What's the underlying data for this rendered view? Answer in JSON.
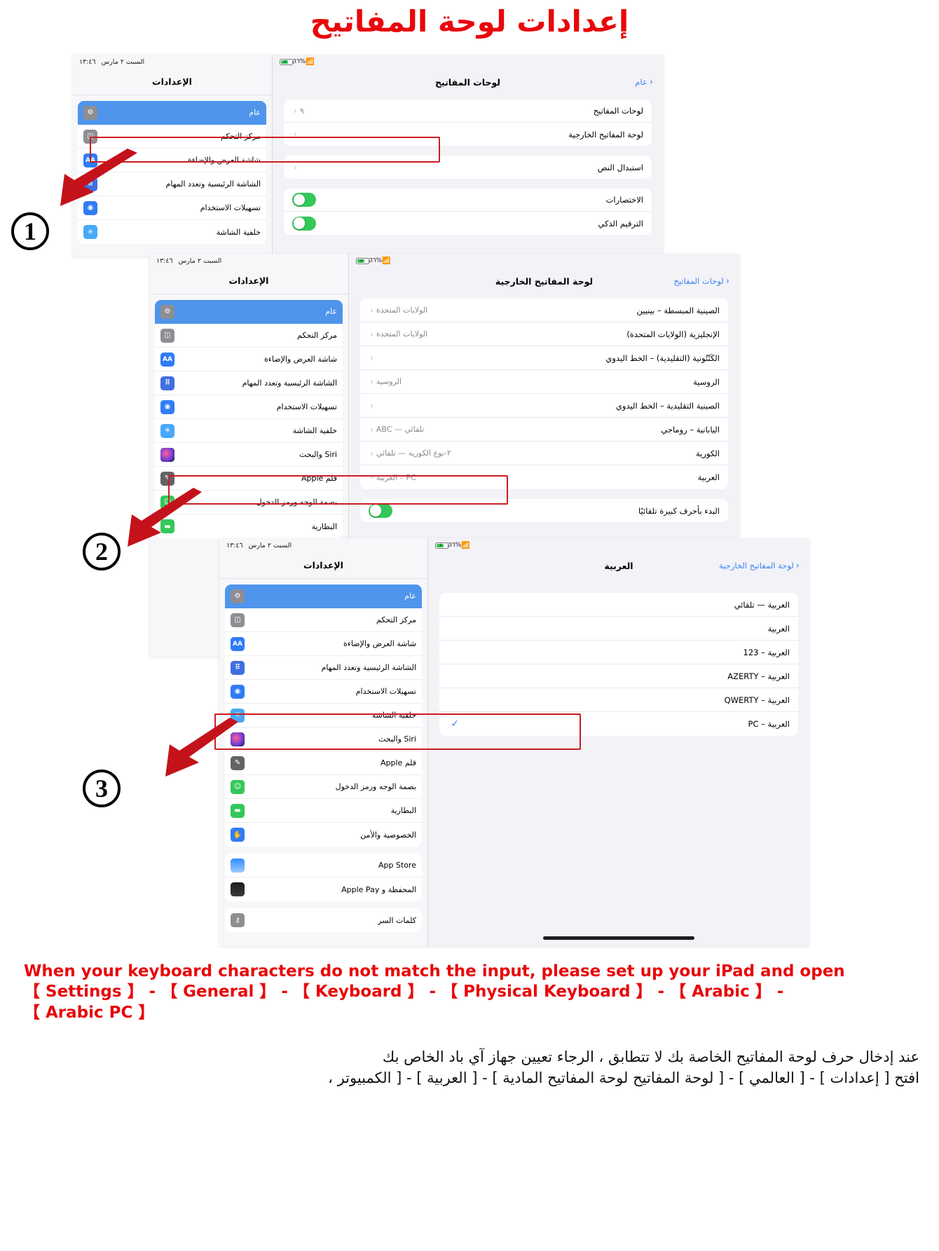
{
  "title": "إعدادات لوحة المفاتيح",
  "statusbar": {
    "battery_pct": "٦٦%",
    "time": "١٣:٤٦",
    "date": "السبت ٢ مارس"
  },
  "settings_sidebar": {
    "header": "الإعدادات",
    "items_short": [
      {
        "label": "عام",
        "icon": "gear-icon",
        "color": "#8e8e93",
        "selected": true
      },
      {
        "label": "مركز التحكم",
        "icon": "control-center-icon",
        "color": "#8e8e93",
        "selected": false
      },
      {
        "label": "شاشة العرض والإضاءة",
        "icon": "display-brightness-icon",
        "color": "#2f7cf6",
        "selected": false
      },
      {
        "label": "الشاشة الرئيسية وتعدد المهام",
        "icon": "home-screen-icon",
        "color": "#3f6fe0",
        "selected": false
      },
      {
        "label": "تسهيلات الاستخدام",
        "icon": "accessibility-icon",
        "color": "#2f7cf6",
        "selected": false
      },
      {
        "label": "خلفية الشاشة",
        "icon": "wallpaper-icon",
        "color": "#48a9f8",
        "selected": false
      }
    ],
    "items_medium": [
      {
        "label": "عام",
        "icon": "gear-icon",
        "color": "#8e8e93",
        "selected": true
      },
      {
        "label": "مركز التحكم",
        "icon": "control-center-icon",
        "color": "#8e8e93",
        "selected": false
      },
      {
        "label": "شاشة العرض والإضاءة",
        "icon": "display-brightness-icon",
        "color": "#2f7cf6",
        "selected": false
      },
      {
        "label": "الشاشة الرئيسية وتعدد المهام",
        "icon": "home-screen-icon",
        "color": "#3f6fe0",
        "selected": false
      },
      {
        "label": "تسهيلات الاستخدام",
        "icon": "accessibility-icon",
        "color": "#2f7cf6",
        "selected": false
      },
      {
        "label": "خلفية الشاشة",
        "icon": "wallpaper-icon",
        "color": "#48a9f8",
        "selected": false
      },
      {
        "label": "Siri والبحث",
        "icon": "siri-icon",
        "color": "#1c1c1e",
        "selected": false
      },
      {
        "label": "قلم Apple",
        "icon": "apple-pencil-icon",
        "color": "#636366",
        "selected": false
      },
      {
        "label": "بصمة الوجه ورمز الدخول",
        "icon": "face-id-icon",
        "color": "#34c759",
        "selected": false
      },
      {
        "label": "البطارية",
        "icon": "battery-icon",
        "color": "#34c759",
        "selected": false
      }
    ],
    "items_long": [
      {
        "label": "عام",
        "icon": "gear-icon",
        "color": "#8e8e93",
        "selected": true
      },
      {
        "label": "مركز التحكم",
        "icon": "control-center-icon",
        "color": "#8e8e93",
        "selected": false
      },
      {
        "label": "شاشة العرض والإضاءة",
        "icon": "display-brightness-icon",
        "color": "#2f7cf6",
        "selected": false
      },
      {
        "label": "الشاشة الرئيسية وتعدد المهام",
        "icon": "home-screen-icon",
        "color": "#3f6fe0",
        "selected": false
      },
      {
        "label": "تسهيلات الاستخدام",
        "icon": "accessibility-icon",
        "color": "#2f7cf6",
        "selected": false
      },
      {
        "label": "خلفية الشاشة",
        "icon": "wallpaper-icon",
        "color": "#48a9f8",
        "selected": false
      },
      {
        "label": "Siri والبحث",
        "icon": "siri-icon",
        "color": "#1c1c1e",
        "selected": false
      },
      {
        "label": "قلم Apple",
        "icon": "apple-pencil-icon",
        "color": "#636366",
        "selected": false
      },
      {
        "label": "بصمة الوجه ورمز الدخول",
        "icon": "face-id-icon",
        "color": "#34c759",
        "selected": false
      },
      {
        "label": "البطارية",
        "icon": "battery-icon",
        "color": "#34c759",
        "selected": false
      },
      {
        "label": "الخصوصية والأمن",
        "icon": "privacy-hand-icon",
        "color": "#2f7cf6",
        "selected": false
      }
    ],
    "items_store": [
      {
        "label": "App Store",
        "icon": "app-store-icon",
        "color": "#3a84f2",
        "selected": false
      },
      {
        "label": "المحفظة و Apple Pay",
        "icon": "wallet-icon",
        "color": "#1c1c1e",
        "selected": false
      }
    ],
    "items_passwords": [
      {
        "label": "كلمات السر",
        "icon": "passwords-key-icon",
        "color": "#8e8e93",
        "selected": false
      }
    ]
  },
  "panel1": {
    "back": "عام",
    "nav_title": "لوحات المفاتيح",
    "rows": [
      {
        "label": "لوحات المفاتيح",
        "value": "٩",
        "chevron": "‹"
      },
      {
        "label": "لوحة المفاتيح الخارجية",
        "value": "",
        "chevron": "‹",
        "highlight": true
      },
      {
        "label": "استبدال النص",
        "value": "",
        "chevron": "‹"
      }
    ],
    "toggle_rows": [
      {
        "label": "الاختصارات",
        "on": true
      },
      {
        "label": "الترقيم الذكي",
        "on": true
      }
    ]
  },
  "panel2": {
    "back": "لوحات المفاتيح",
    "nav_title": "لوحة المفاتيح الخارجية",
    "rows": [
      {
        "label": "الصينية المبسطة – بينيين",
        "value": "الولايات المتحدة",
        "chevron": "‹"
      },
      {
        "label": "الإنجليزية (الولايات المتحدة)",
        "value": "الولايات المتحدة",
        "chevron": "‹"
      },
      {
        "label": "الكَنْتُونية (التقليدية) – الخط اليدوي",
        "value": "",
        "chevron": "‹"
      },
      {
        "label": "الروسية",
        "value": "الروسية",
        "chevron": "‹"
      },
      {
        "label": "الصينية التقليدية – الخط اليدوي",
        "value": "",
        "chevron": "‹"
      },
      {
        "label": "اليابانية – روماجي",
        "value": "ABC — تلقائي",
        "chevron": "‹"
      },
      {
        "label": "الكورية",
        "value": "٢-نوع الكورية — تلقائي",
        "chevron": "‹"
      },
      {
        "label": "العربية",
        "value": "العربية – PC",
        "chevron": "‹",
        "highlight": true
      }
    ],
    "toggle_rows": [
      {
        "label": "البدء بأحرف كبيرة تلقائيًا",
        "on": true
      }
    ]
  },
  "panel3": {
    "back": "لوحة المفاتيح الخارجية",
    "nav_title": "العربية",
    "options": [
      {
        "label": "العربية — تلقائي",
        "checked": false
      },
      {
        "label": "العربية",
        "checked": false
      },
      {
        "label": "العربية – 123",
        "checked": false
      },
      {
        "label": "العربية – AZERTY",
        "checked": false
      },
      {
        "label": "العربية – QWERTY",
        "checked": false
      },
      {
        "label": "العربية – PC",
        "checked": true,
        "highlight": true
      }
    ]
  },
  "step_markers": [
    "1",
    "2",
    "3"
  ],
  "caption": {
    "en_line1": "When your keyboard characters do not match the input, please set up your iPad and open",
    "en_line2": "【 Settings 】 - 【 General 】 - 【 Keyboard 】 - 【 Physical Keyboard 】 - 【 Arabic 】 -",
    "en_line3": "【 Arabic PC 】",
    "ar_line1": "عند إدخال حرف لوحة المفاتيح الخاصة بك لا تتطابق ، الرجاء تعيين جهاز آي باد الخاص بك",
    "ar_line2": "افتح [ إعدادات ] - [ العالمي ] - [ لوحة المفاتيح لوحة المفاتيح المادية ] - [ العربية ] - [ الكمبيوتر ،"
  },
  "colors": {
    "accent_red": "#e8070b",
    "highlight_red": "#cc1d20",
    "ios_blue": "#3a84f2",
    "selected_blue": "#4e95eb",
    "toggle_green": "#34c759"
  }
}
